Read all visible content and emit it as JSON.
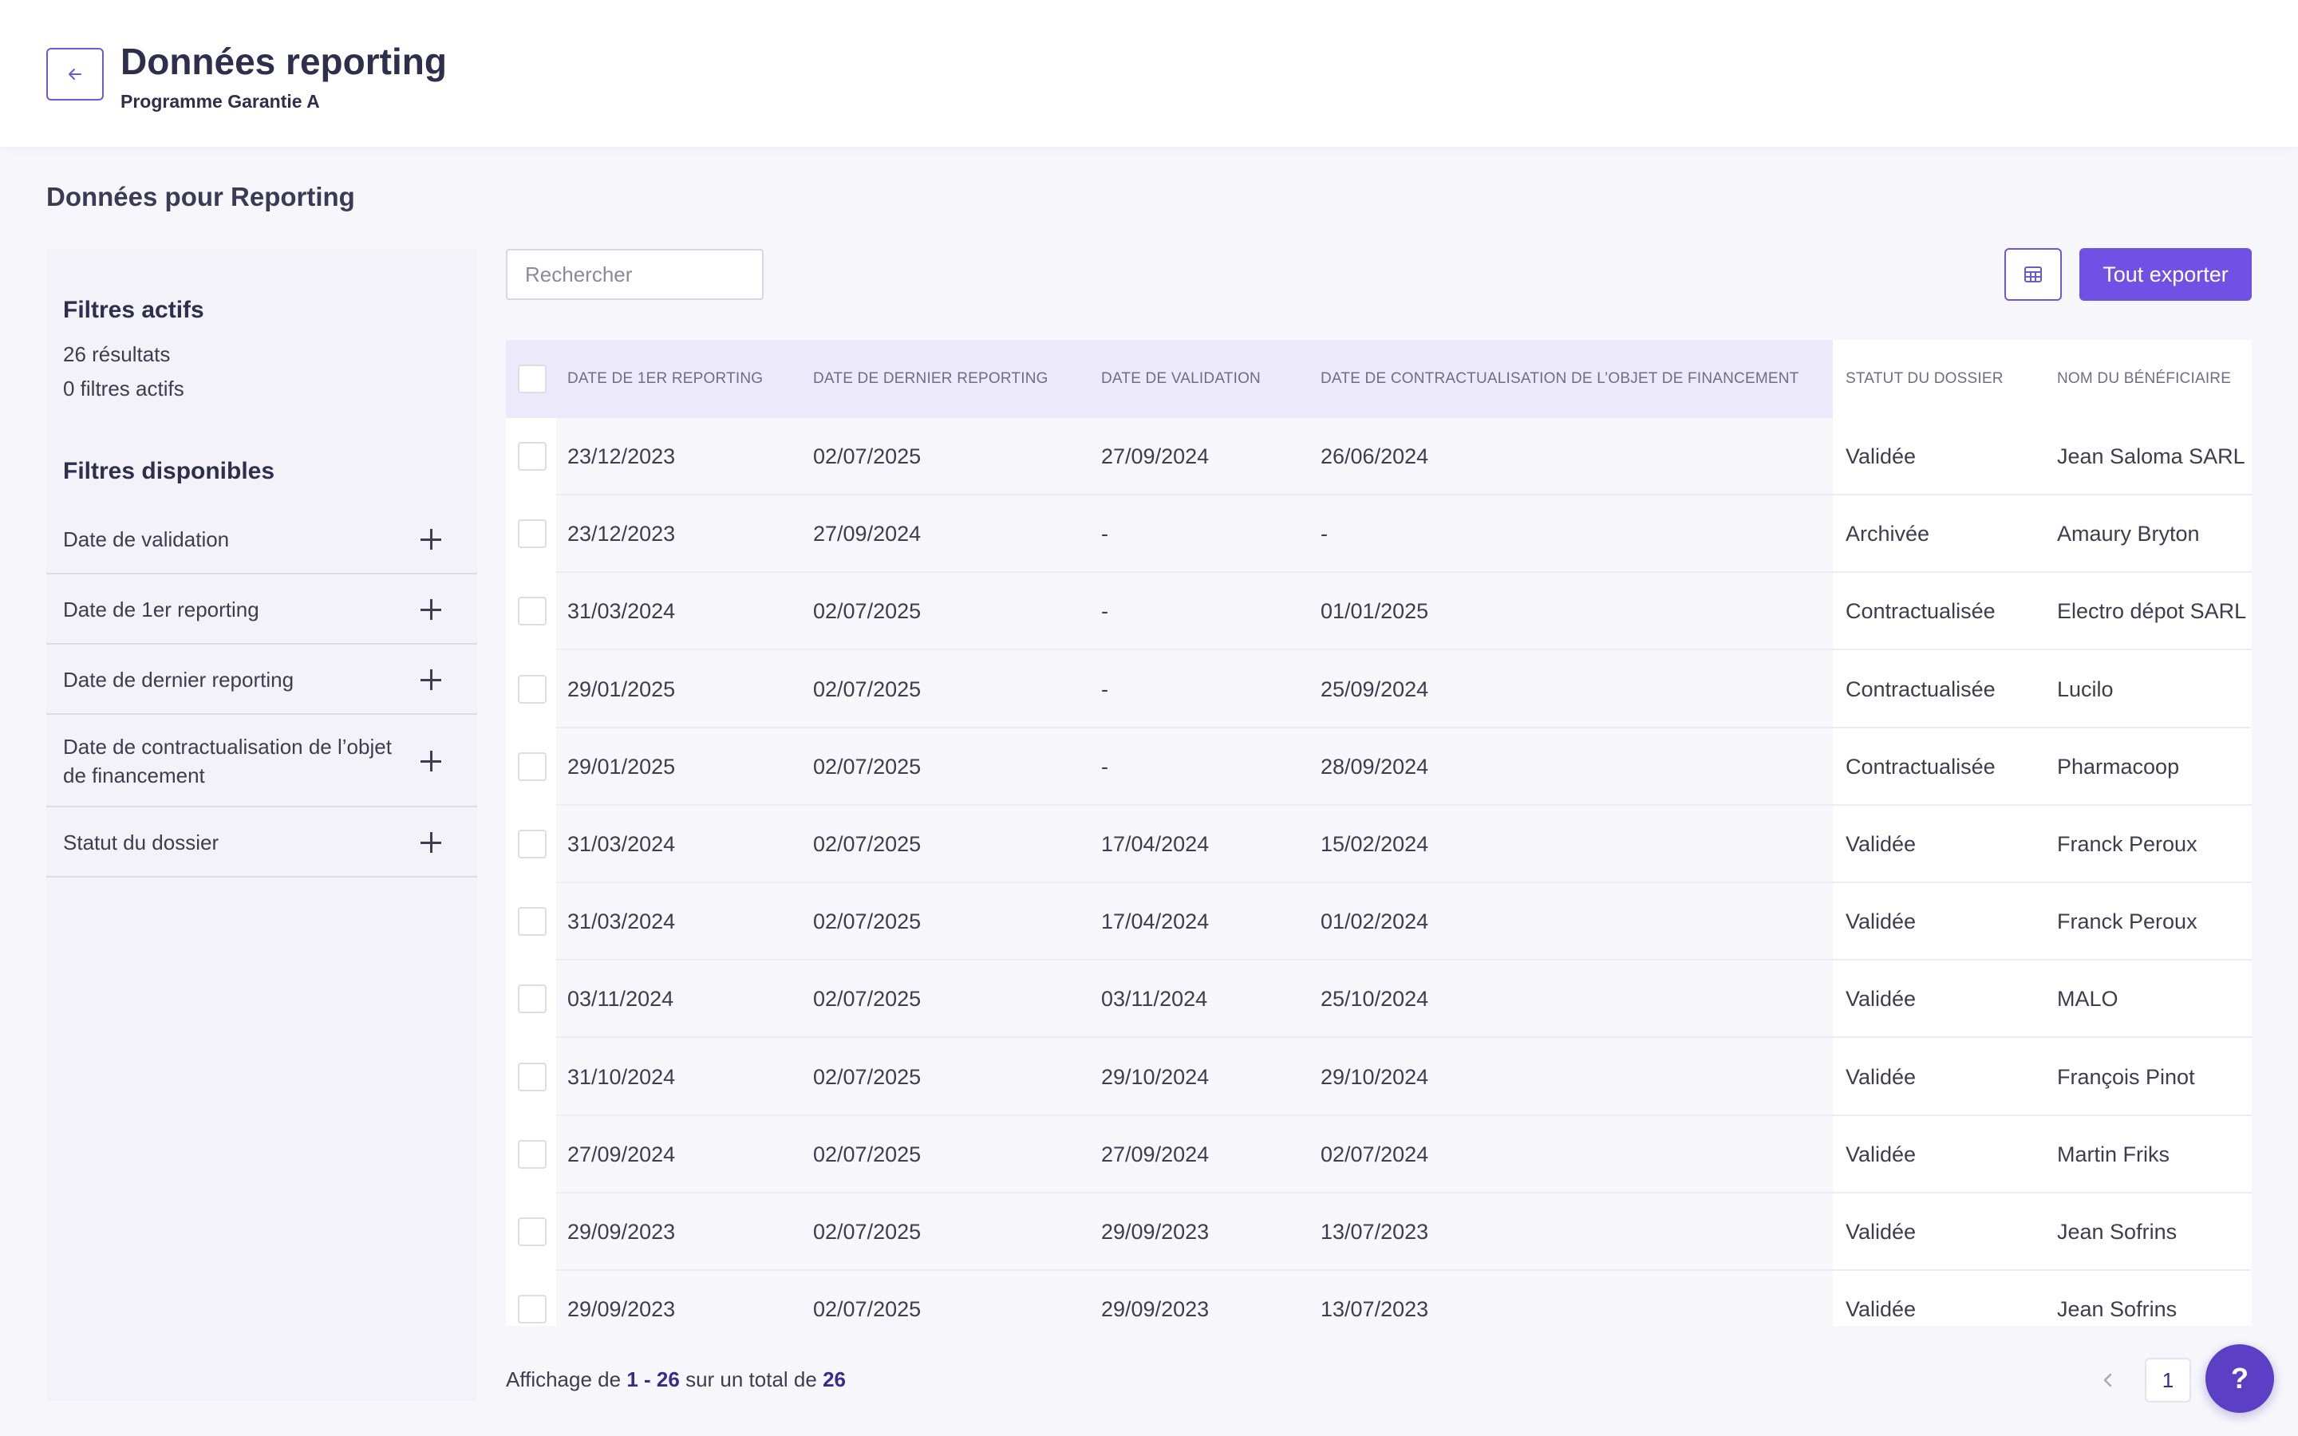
{
  "header": {
    "title": "Données reporting",
    "subtitle": "Programme Garantie A",
    "back_icon": "arrow-left-icon"
  },
  "section_title": "Données pour Reporting",
  "sidebar": {
    "active_heading": "Filtres actifs",
    "results_count": "26 résultats",
    "active_filters_count": "0 filtres actifs",
    "available_heading": "Filtres disponibles",
    "filters": [
      {
        "label": "Date de validation"
      },
      {
        "label": "Date de 1er reporting"
      },
      {
        "label": "Date de dernier reporting"
      },
      {
        "label": "Date de contractualisation de l’objet de financement"
      },
      {
        "label": "Statut du dossier"
      }
    ]
  },
  "toolbar": {
    "search_placeholder": "Rechercher",
    "grid_icon": "table-grid-icon",
    "export_label": "Tout exporter"
  },
  "table": {
    "headers": [
      "Date de 1er reporting",
      "Date de dernier reporting",
      "Date de validation",
      "Date de contractualisation de l’objet de financement",
      "Statut du dossier",
      "Nom du bénéficiaire"
    ],
    "rows": [
      [
        "23/12/2023",
        "02/07/2025",
        "27/09/2024",
        "26/06/2024",
        "Validée",
        "Jean Saloma SARL"
      ],
      [
        "23/12/2023",
        "27/09/2024",
        "-",
        "-",
        "Archivée",
        "Amaury Bryton"
      ],
      [
        "31/03/2024",
        "02/07/2025",
        "-",
        "01/01/2025",
        "Contractualisée",
        "Electro dépot SARL"
      ],
      [
        "29/01/2025",
        "02/07/2025",
        "-",
        "25/09/2024",
        "Contractualisée",
        "Lucilo"
      ],
      [
        "29/01/2025",
        "02/07/2025",
        "-",
        "28/09/2024",
        "Contractualisée",
        "Pharmacoop"
      ],
      [
        "31/03/2024",
        "02/07/2025",
        "17/04/2024",
        "15/02/2024",
        "Validée",
        "Franck Peroux"
      ],
      [
        "31/03/2024",
        "02/07/2025",
        "17/04/2024",
        "01/02/2024",
        "Validée",
        "Franck Peroux"
      ],
      [
        "03/11/2024",
        "02/07/2025",
        "03/11/2024",
        "25/10/2024",
        "Validée",
        "MALO"
      ],
      [
        "31/10/2024",
        "02/07/2025",
        "29/10/2024",
        "29/10/2024",
        "Validée",
        "François Pinot"
      ],
      [
        "27/09/2024",
        "02/07/2025",
        "27/09/2024",
        "02/07/2024",
        "Validée",
        "Martin Friks"
      ],
      [
        "29/09/2023",
        "02/07/2025",
        "29/09/2023",
        "13/07/2023",
        "Validée",
        "Jean Sofrins"
      ],
      [
        "29/09/2023",
        "02/07/2025",
        "29/09/2023",
        "13/07/2023",
        "Validée",
        "Jean Sofrins"
      ]
    ]
  },
  "pagination": {
    "prefix": "Affichage de",
    "range": "1 - 26",
    "middle": "sur un total de",
    "total": "26",
    "current_page": "1",
    "prev_icon": "chevron-left-icon"
  },
  "help": {
    "label": "?",
    "icon": "help-icon"
  },
  "colors": {
    "accent": "#7150e6",
    "accent_dark": "#5b3fc4",
    "header_highlight": "#ece9fb",
    "title": "#2e2f4d"
  }
}
